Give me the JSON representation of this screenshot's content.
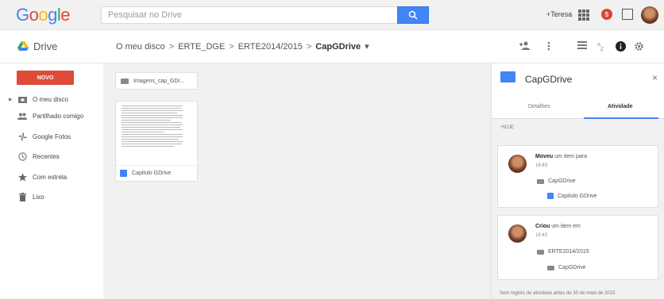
{
  "header": {
    "logo": {
      "G": "G",
      "o1": "o",
      "o2": "o",
      "g": "g",
      "l": "l",
      "e": "e"
    },
    "search_placeholder": "Pesquisar no Drive",
    "user_link": "+Teresa",
    "notification_count": "5"
  },
  "toolbar": {
    "app_title": "Drive",
    "breadcrumb": [
      "O meu disco",
      "ERTE_DGE",
      "ERTE2014/2015",
      "CapGDrive"
    ],
    "separator": ">",
    "dropdown": "▾"
  },
  "sidebar": {
    "new_button": "NOVO",
    "items": [
      {
        "label": "O meu disco",
        "icon": "drive-folder-icon"
      },
      {
        "label": "Partilhado comigo",
        "icon": "shared-people-icon"
      },
      {
        "label": "Google Fotos",
        "icon": "photos-pinwheel-icon"
      },
      {
        "label": "Recentes",
        "icon": "clock-icon"
      },
      {
        "label": "Com estrela",
        "icon": "star-icon"
      },
      {
        "label": "Lixo",
        "icon": "trash-icon"
      }
    ]
  },
  "content": {
    "folder_name": "Imagens_cap_GDr...",
    "doc_name": "Capitulo GDrive"
  },
  "details": {
    "title": "CapGDrive",
    "close": "×",
    "tabs": [
      "Detalhes",
      "Atividade"
    ],
    "section_label": "HOJE",
    "activities": [
      {
        "action": "Moveu",
        "rest": " um item para",
        "time": "16:43",
        "target_folder": "CapGDrive",
        "item": "Capitulo GDrive"
      },
      {
        "action": "Criou",
        "rest": " um item em",
        "time": "16:43",
        "target_folder": "ERTE2014/2015",
        "item": "CapGDrive"
      }
    ],
    "footer": "Sem registo de atividade antes de 30 de maio de 2015"
  },
  "colors": {
    "accent": "#4285f4",
    "new_button": "#dd4b39",
    "notification": "#db4437"
  }
}
